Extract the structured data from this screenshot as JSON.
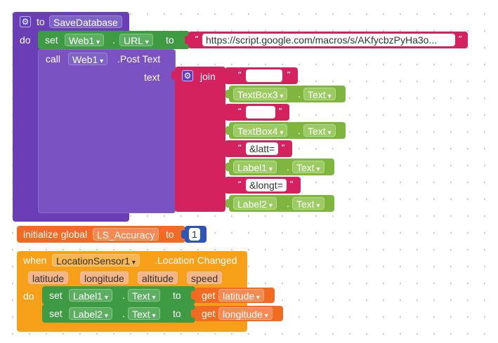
{
  "procedure": {
    "to_label": "to",
    "name": "SaveDatabase",
    "do_label": "do",
    "set_block": {
      "set_label": "set",
      "component": "Web1",
      "dot": ".",
      "property": "URL",
      "to_label": "to",
      "url_value": "https://script.google.com/macros/s/AKfycbzPyHa3o..."
    },
    "call_block": {
      "call_label": "call",
      "component": "Web1",
      "method": ".Post Text",
      "arg_label": "text",
      "join_label": "join",
      "items": [
        {
          "kind": "text",
          "value": "",
          "redacted": true
        },
        {
          "kind": "getter",
          "component": "TextBox3",
          "dot": ".",
          "property": "Text"
        },
        {
          "kind": "text",
          "value": "",
          "redacted": true
        },
        {
          "kind": "getter",
          "component": "TextBox4",
          "dot": ".",
          "property": "Text"
        },
        {
          "kind": "text",
          "value": "&latt="
        },
        {
          "kind": "getter",
          "component": "Label1",
          "dot": ".",
          "property": "Text"
        },
        {
          "kind": "text",
          "value": "&longt="
        },
        {
          "kind": "getter",
          "component": "Label2",
          "dot": ".",
          "property": "Text"
        }
      ]
    }
  },
  "global_var": {
    "init_label": "initialize global",
    "name": "LS_Accuracy",
    "to_label": "to",
    "value": "1"
  },
  "event": {
    "when_label": "when",
    "component": "LocationSensor1",
    "event_name": ".Location Changed",
    "params": [
      "latitude",
      "longitude",
      "altitude",
      "speed"
    ],
    "do_label": "do",
    "statements": [
      {
        "set_label": "set",
        "component": "Label1",
        "dot": ".",
        "property": "Text",
        "to_label": "to",
        "get_label": "get",
        "var": "latitude"
      },
      {
        "set_label": "set",
        "component": "Label2",
        "dot": ".",
        "property": "Text",
        "to_label": "to",
        "get_label": "get",
        "var": "longitude"
      }
    ]
  },
  "glyphs": {
    "quote_open": "“",
    "quote_close": "”",
    "gear": "⚙"
  },
  "colors": {
    "procedure": "#6a3fb5",
    "text": "#d4225e",
    "component_setter": "#3f9a44",
    "component_getter": "#7fb63f",
    "variable": "#f26b22",
    "event": "#f6a01a",
    "math": "#2f54b8"
  }
}
